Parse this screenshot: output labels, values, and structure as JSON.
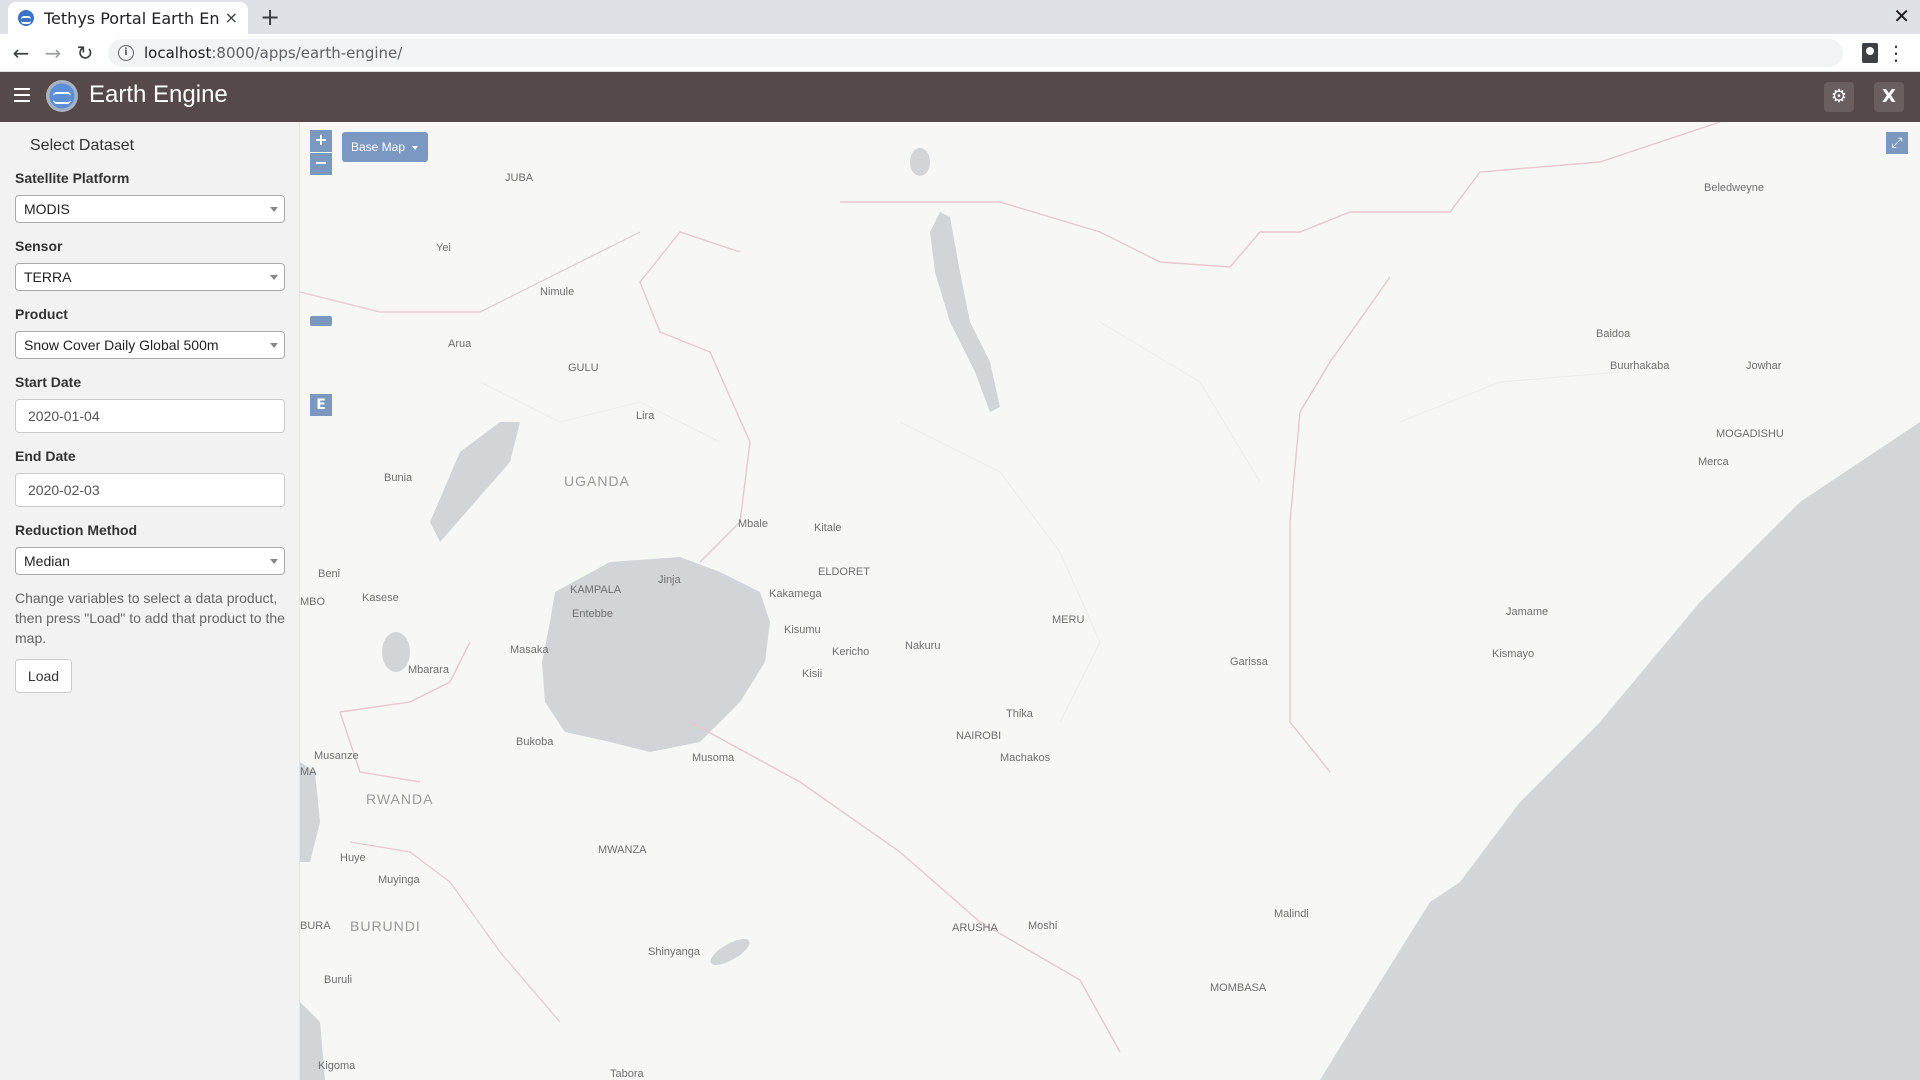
{
  "browser": {
    "tab_title": "Tethys Portal Earth Engine",
    "tab_close": "×",
    "new_tab": "+",
    "window_close": "✕",
    "url_host": "localhost",
    "url_path": ":8000/apps/earth-engine/"
  },
  "header": {
    "title": "Earth Engine",
    "close_label": "X"
  },
  "sidebar": {
    "heading": "Select Dataset",
    "platform_label": "Satellite Platform",
    "platform_value": "MODIS",
    "sensor_label": "Sensor",
    "sensor_value": "TERRA",
    "product_label": "Product",
    "product_value": "Snow Cover Daily Global 500m",
    "start_label": "Start Date",
    "start_value": "2020-01-04",
    "end_label": "End Date",
    "end_value": "2020-02-03",
    "reduction_label": "Reduction Method",
    "reduction_value": "Median",
    "help": "Change variables to select a data product, then press \"Load\" to add that product to the map.",
    "load_label": "Load"
  },
  "map": {
    "zoom_in": "+",
    "zoom_out": "−",
    "basemap_label": "Base Map",
    "e_control": "E",
    "fullscreen": "⤢",
    "countries": [
      "UGANDA",
      "RWANDA",
      "BURUNDI"
    ],
    "cities": [
      "JUBA",
      "Yei",
      "Nimule",
      "Arua",
      "GULU",
      "Lira",
      "Bunia",
      "Mbale",
      "Kitale",
      "ELDORET",
      "Beni",
      "MBO",
      "Kasese",
      "KAMPALA",
      "Jinja",
      "Entebbe",
      "Kakamega",
      "Kisumu",
      "Kericho",
      "Nakuru",
      "MERU",
      "Masaka",
      "Kisii",
      "Mbarara",
      "Thika",
      "NAIROBI",
      "Machakos",
      "Bukoba",
      "Musoma",
      "Musanze",
      "MA",
      "Huye",
      "Muyinga",
      "MWANZA",
      "BURA",
      "Buruli",
      "ARUSHA",
      "Moshi",
      "Shinyanga",
      "Kigoma",
      "Tabora",
      "Beledweyne",
      "Baidoa",
      "Buurhakaba",
      "Jowhar",
      "MOGADISHU",
      "Merca",
      "Jamame",
      "Kismayo",
      "Garissa",
      "Malindi",
      "MOMBASA"
    ]
  }
}
